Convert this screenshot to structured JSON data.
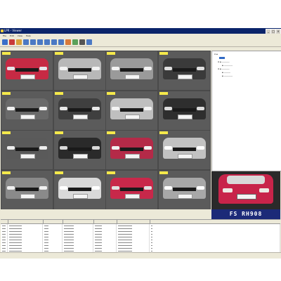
{
  "window": {
    "title": "LPR - Viewer",
    "controls": [
      "_",
      "□",
      "×"
    ]
  },
  "menu": [
    "File",
    "Edit",
    "View",
    "Help"
  ],
  "toolbar": {
    "buttons": [
      {
        "icon": "open-icon",
        "color": "#3a6fc9"
      },
      {
        "icon": "record-icon",
        "color": "#c93a3a"
      },
      {
        "icon": "folder-icon",
        "color": "#d9a13a"
      },
      {
        "icon": "camera-1-icon",
        "color": "#4b79c4"
      },
      {
        "icon": "camera-2-icon",
        "color": "#4b79c4"
      },
      {
        "icon": "camera-3-icon",
        "color": "#4b79c4"
      },
      {
        "icon": "camera-4-icon",
        "color": "#4b79c4"
      },
      {
        "icon": "grid-view-icon",
        "color": "#4b79c4"
      },
      {
        "icon": "database-icon",
        "color": "#4b79c4"
      },
      {
        "icon": "report-icon",
        "color": "#d97a3a"
      },
      {
        "icon": "settings-icon",
        "color": "#5aa15a"
      },
      {
        "icon": "print-icon",
        "color": "#555555"
      },
      {
        "icon": "help-icon",
        "color": "#4b79c4"
      }
    ]
  },
  "recognized_plate": "FS RH908",
  "camera_tiles": [
    {
      "car": "#c62a44",
      "light": "#e6e6ea"
    },
    {
      "car": "#b8b8b8",
      "light": "#f2f2f2"
    },
    {
      "car": "#9a9a9a",
      "light": "#f2f2f2"
    },
    {
      "car": "#3a3a3a",
      "light": "#e0e0e0"
    },
    {
      "car": "#6a6a6a",
      "light": "#f0f0f0"
    },
    {
      "car": "#3f3f3f",
      "light": "#e8e8e8"
    },
    {
      "car": "#bfbfbf",
      "light": "#f4f4f4"
    },
    {
      "car": "#2e2e2e",
      "light": "#dcdcdc"
    },
    {
      "car": "#5a5a5a",
      "light": "#ececec"
    },
    {
      "car": "#2a2a2a",
      "light": "#d9d9d9"
    },
    {
      "car": "#b42a48",
      "light": "#f0f0f0"
    },
    {
      "car": "#c2c2c2",
      "light": "#ffffff"
    },
    {
      "car": "#8a8a8a",
      "light": "#f0f0f0"
    },
    {
      "car": "#d9d9d9",
      "light": "#ffffff"
    },
    {
      "car": "#c8284a",
      "light": "#e0e0e0"
    },
    {
      "car": "#a8a8a8",
      "light": "#ffffff"
    }
  ],
  "colors": {
    "title_bar": "#0a246a",
    "plate_panel": "#1c2a78",
    "tag": "#f5e94a"
  }
}
